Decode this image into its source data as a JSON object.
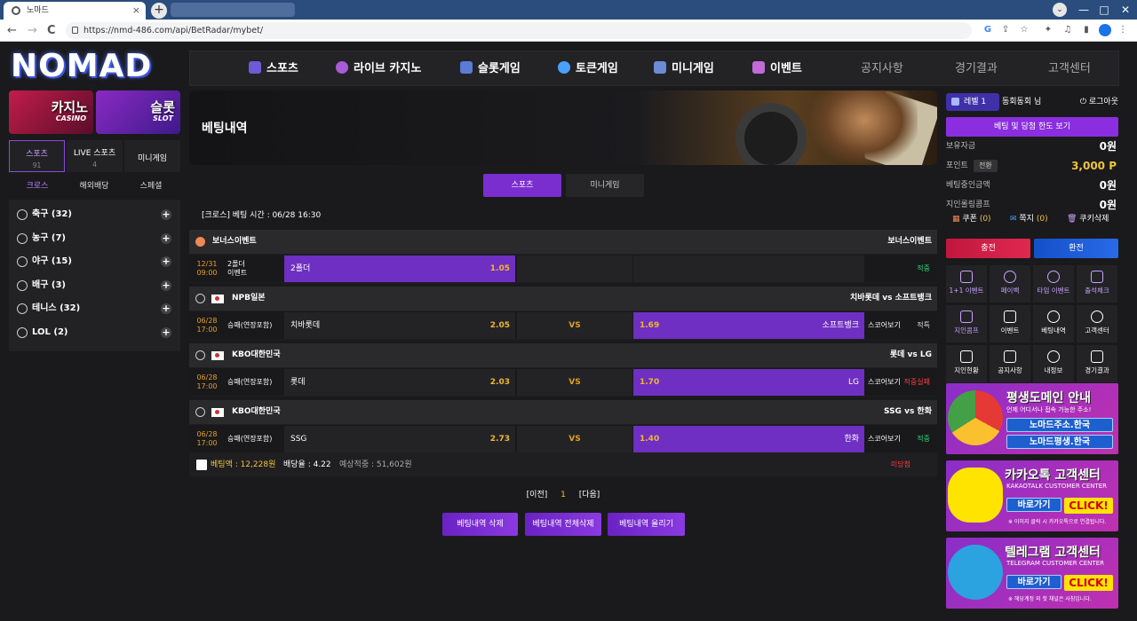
{
  "browser": {
    "tab_title": "노마드",
    "close": "×",
    "new_tab": "+",
    "url": "https://nmd-486.com/api/BetRadar/mybet/",
    "nav_back": "←",
    "nav_forward": "→",
    "reload": "C",
    "win_min": "—",
    "win_max": "□",
    "win_close": "✕",
    "chevron": "⌄"
  },
  "logo": "NOMAD",
  "topnav": [
    {
      "label": "스포츠"
    },
    {
      "label": "라이브 카지노"
    },
    {
      "label": "슬롯게임"
    },
    {
      "label": "토큰게임"
    },
    {
      "label": "미니게임"
    },
    {
      "label": "이벤트"
    },
    {
      "label": "공지사항"
    },
    {
      "label": "경기결과"
    },
    {
      "label": "고객센터"
    }
  ],
  "promos": [
    {
      "title": "카지노",
      "sub": "CASINO"
    },
    {
      "title": "슬롯",
      "sub": "SLOT"
    }
  ],
  "left_tabs": [
    {
      "label": "스포츠",
      "count": "91"
    },
    {
      "label": "LIVE 스포츠",
      "count": "4"
    },
    {
      "label": "미니게임",
      "count": ""
    }
  ],
  "sub_tabs": [
    "크로스",
    "해외배당",
    "스페셜"
  ],
  "sports": [
    {
      "name": "축구 (32)",
      "icon": "soccer-icon"
    },
    {
      "name": "농구 (7)",
      "icon": "basketball-icon"
    },
    {
      "name": "야구 (15)",
      "icon": "baseball-icon"
    },
    {
      "name": "배구 (3)",
      "icon": "volleyball-icon"
    },
    {
      "name": "테니스 (32)",
      "icon": "tennis-icon"
    },
    {
      "name": "LOL (2)",
      "icon": "lol-icon"
    }
  ],
  "plus": "+",
  "banner_title": "베팅내역",
  "content_tabs": [
    "스포츠",
    "미니게임"
  ],
  "bet_header": "[크로스] 베팅 시간 : 06/28 16:30",
  "bets": [
    {
      "league": "보너스이벤트",
      "teams": "보너스이벤트",
      "date": "12/31",
      "time": "09:00",
      "market": "2폴더",
      "market2": "이벤트",
      "home": "2폴더",
      "home_odds": "1.05",
      "draw": "",
      "away": "",
      "away_odds": "",
      "score": "",
      "status": "적중",
      "home_sel": true,
      "away_sel": false
    },
    {
      "league": "NPB일본",
      "teams": "치바롯데 vs 소프트뱅크",
      "date": "06/28",
      "time": "17:00",
      "market": "승패(연장포함)",
      "market2": "",
      "home": "치바롯데",
      "home_odds": "2.05",
      "draw": "VS",
      "away": "소프트뱅크",
      "away_odds": "1.69",
      "score": "스코어보기",
      "status": "적특",
      "home_sel": false,
      "away_sel": true
    },
    {
      "league": "KBO대한민국",
      "teams": "롯데 vs LG",
      "date": "06/28",
      "time": "17:00",
      "market": "승패(연장포함)",
      "market2": "",
      "home": "롯데",
      "home_odds": "2.03",
      "draw": "VS",
      "away": "LG",
      "away_odds": "1.70",
      "score": "스코어보기",
      "status": "적중실패",
      "home_sel": false,
      "away_sel": true
    },
    {
      "league": "KBO대한민국",
      "teams": "SSG vs 한화",
      "date": "06/28",
      "time": "17:00",
      "market": "승패(연장포함)",
      "market2": "",
      "home": "SSG",
      "home_odds": "2.73",
      "draw": "VS",
      "away": "한화",
      "away_odds": "1.40",
      "score": "스코어보기",
      "status": "적중",
      "home_sel": false,
      "away_sel": true
    }
  ],
  "summary": {
    "amount": "베팅액 : 12,228원",
    "rate": "배당율 : 4.22",
    "expected": "예상적중 : 51,602원",
    "status": "미당첨"
  },
  "pager": {
    "prev": "[이전]",
    "page": "1",
    "next": "[다음]"
  },
  "actions": [
    "베팅내역 삭제",
    "베팅내역 전체삭제",
    "베팅내역 올리기"
  ],
  "user": {
    "level": "레벨 1",
    "name": "동회동회 님",
    "logout": "로그아웃",
    "limit_btn": "베팅 및 당첨 한도 보기",
    "holding_label": "보유자금",
    "holding_value": "0원",
    "point_label": "포인트",
    "point_tag": "전환",
    "point_value": "3,000 P",
    "betting_label": "베팅중인금액",
    "betting_value": "0원",
    "rolling_label": "지인롤링콤프",
    "rolling_value": "0원",
    "coupon_label": "쿠폰",
    "coupon_count": "(0)",
    "note_label": "쪽지",
    "note_count": "(0)",
    "cookie_label": "쿠키삭제",
    "deposit": "충전",
    "withdraw": "환전"
  },
  "menu_grid": [
    {
      "label": "1+1 이벤트",
      "icon": "gift-icon"
    },
    {
      "label": "페이백",
      "icon": "refresh-icon"
    },
    {
      "label": "타임 이벤트",
      "icon": "clock-icon"
    },
    {
      "label": "출석체크",
      "icon": "calendar-icon"
    },
    {
      "label": "지인콤프",
      "icon": "gift-box-icon"
    },
    {
      "label": "이벤트",
      "icon": "rocket-icon"
    },
    {
      "label": "베팅내역",
      "icon": "gear-icon"
    },
    {
      "label": "고객센터",
      "icon": "headset-icon"
    },
    {
      "label": "지인현황",
      "icon": "users-icon"
    },
    {
      "label": "공지사항",
      "icon": "mic-icon"
    },
    {
      "label": "내정보",
      "icon": "settings-icon"
    },
    {
      "label": "경기결과",
      "icon": "edit-icon"
    }
  ],
  "ads": [
    {
      "title": "평생도메인 안내",
      "sub": "언제 어디서나 접속 가능한 주소!",
      "b1": "노마드주소.한국",
      "b2": "노마드평생.한국",
      "cap": ""
    },
    {
      "title": "카카오톡 고객센터",
      "sub": "KAKAOTALK CUSTOMER CENTER",
      "b1": "바로가기",
      "b2": "",
      "cap": "※ 이미지 클릭 시 카카오톡으로 연결됩니다.",
      "click": "CLICK!"
    },
    {
      "title": "텔레그램 고객센터",
      "sub": "TELEGRAM CUSTOMER CENTER",
      "b1": "바로가기",
      "b2": "",
      "cap": "※ 해당계정 외 첫 채널은 사칭입니다.",
      "click": "CLICK!"
    }
  ],
  "colors": {
    "accent": "#7b2ed0",
    "gold": "#f0c43a",
    "bg": "#1a1a1c"
  }
}
